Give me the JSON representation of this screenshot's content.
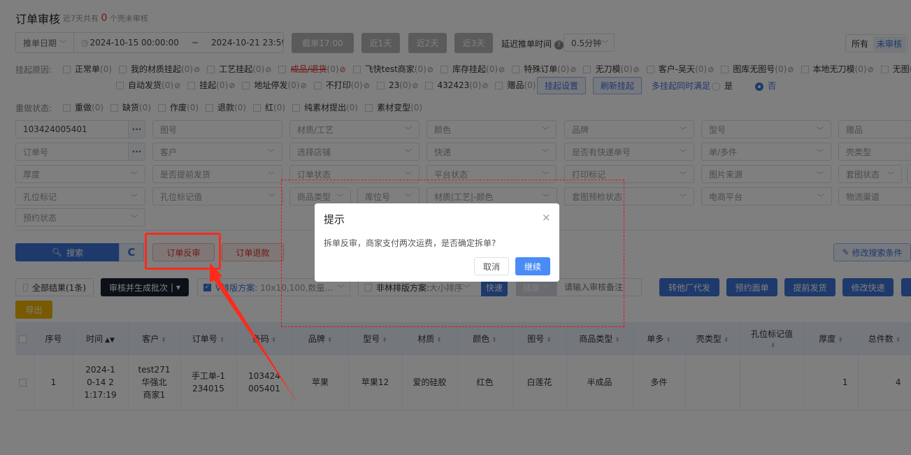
{
  "header": {
    "title": "订单审核",
    "subtitle_prefix": "近7天共有",
    "pending_count": "0",
    "subtitle_suffix": "个壳未审核"
  },
  "date_filter": {
    "type": "推单日期",
    "start": "2024-10-15 00:00:00",
    "separator": "~",
    "end": "2024-10-21 23:59:59"
  },
  "quick_buttons": [
    "截单17:00",
    "近1天",
    "近2天",
    "近3天"
  ],
  "delay": {
    "label": "延迟推单时间",
    "value": "0.5分钟"
  },
  "scope_toggle": {
    "options": [
      "所有",
      "未审核"
    ],
    "selected": "未审核"
  },
  "hang_reasons": {
    "label": "挂起原因:",
    "row1": [
      {
        "name": "正常单",
        "count": "(0)",
        "ban": false
      },
      {
        "name": "我的材质挂起",
        "count": "(0)",
        "ban": true
      },
      {
        "name": "工艺挂起",
        "count": "(0)",
        "ban": true
      },
      {
        "name": "成品/退货",
        "count": "(0)",
        "ban": true,
        "red": true
      },
      {
        "name": "飞快test商家",
        "count": "(0)",
        "ban": true
      },
      {
        "name": "库存挂起",
        "count": "(0)",
        "ban": true
      },
      {
        "name": "特殊订单",
        "count": "(0)",
        "ban": true
      },
      {
        "name": "无刀模",
        "count": "(0)",
        "ban": true
      },
      {
        "name": "客户-吴天",
        "count": "(0)",
        "ban": true
      },
      {
        "name": "图库无图号",
        "count": "(0)",
        "ban": true
      },
      {
        "name": "本地无刀模",
        "count": "(0)",
        "ban": true
      },
      {
        "name": "无图",
        "count": "(0)",
        "ban": true
      }
    ],
    "row2": [
      {
        "name": "自动发货",
        "count": "(0)",
        "ban": true
      },
      {
        "name": "挂起",
        "count": "(0)",
        "ban": true
      },
      {
        "name": "地址停发",
        "count": "(0)",
        "ban": true
      },
      {
        "name": "不打印",
        "count": "(0)",
        "ban": true
      },
      {
        "name": "23",
        "count": "(0)",
        "ban": true
      },
      {
        "name": "432423",
        "count": "(0)",
        "ban": true
      },
      {
        "name": "赠品",
        "count": "(0)",
        "ban": true
      }
    ],
    "settings_button": "挂起设置",
    "refresh_button": "刷新挂起",
    "multi_label": "多挂起同时满足",
    "radio_yes": "是",
    "radio_no": "否",
    "radio_selected": "否"
  },
  "redo_status": {
    "label": "重做状态:",
    "items": [
      {
        "name": "重做",
        "count": "(0)"
      },
      {
        "name": "缺货",
        "count": "(0)"
      },
      {
        "name": "作废",
        "count": "(0)"
      },
      {
        "name": "退款",
        "count": "(0)"
      },
      {
        "name": "红",
        "count": "(0)"
      },
      {
        "name": "纯素材提出",
        "count": "(0)"
      },
      {
        "name": "素材变型",
        "count": "(0)"
      }
    ]
  },
  "filters": [
    [
      {
        "text": "103424005401",
        "value": true,
        "more": true
      },
      {
        "text": "图号"
      },
      {
        "text": "材质/工艺",
        "chev": true
      },
      {
        "text": "颜色",
        "chev": true
      },
      {
        "text": "品牌",
        "chev": true
      },
      {
        "text": "型号",
        "chev": true
      },
      {
        "text": "赠品"
      }
    ],
    [
      {
        "text": "订单号",
        "more": true
      },
      {
        "text": "客户",
        "chev": true
      },
      {
        "text": "选择店铺",
        "chev": true
      },
      {
        "text": "快递",
        "chev": true
      },
      {
        "text": "是否有快递单号",
        "chev": true
      },
      {
        "text": "单/多件",
        "chev": true
      },
      {
        "text": "壳类型"
      }
    ],
    [
      {
        "text": "厚度",
        "chev": true
      },
      {
        "text": "是否提前发货",
        "chev": true
      },
      {
        "text": "订单状态",
        "chev": true
      },
      {
        "text": "平台状态",
        "chev": true
      },
      {
        "text": "打印标记",
        "chev": true
      },
      {
        "text": "图片来源",
        "chev": true
      },
      {
        "text": "套图状态",
        "chev": true
      }
    ],
    [
      {
        "text": "孔位标记",
        "chev": true
      },
      {
        "text": "孔位标记值",
        "chev": true
      },
      {
        "text": "商品类型",
        "chev": true
      },
      {
        "text": "库位号",
        "chev": true
      },
      {
        "text": "材质|工艺|-颜色",
        "chev": true
      },
      {
        "text": "套图预检状态",
        "chev": true
      },
      {
        "text": "电商平台",
        "chev": true
      },
      {
        "text": "物流渠道"
      }
    ],
    [
      {
        "text": "预约状态",
        "chev": true
      }
    ]
  ],
  "actions": {
    "search": "搜索",
    "reverse_review": "订单反审",
    "refund": "订单退款",
    "edit_conditions": "修改搜索条件"
  },
  "toolbar": {
    "all_results": "全部结果(1条)",
    "review_batch": "审核并生成批次",
    "layout_label": "V排版方案:",
    "layout_value": "10x10,100,数量...",
    "nonlin_label": "非林排版方案:",
    "nonlin_value": "大小排序",
    "fast": "快速",
    "flag": "插旗",
    "remark_placeholder": "请输入审核备注",
    "buttons": [
      "转他厂代发",
      "预约面单",
      "提前发货",
      "修改快递"
    ],
    "export": "导出"
  },
  "table": {
    "columns": [
      "序号",
      "时间",
      "客户",
      "订单号",
      "条码",
      "品牌",
      "型号",
      "材质",
      "颜色",
      "图号",
      "商品类型",
      "单多",
      "壳类型",
      "孔位标记值",
      "厚度",
      "总件数"
    ],
    "rows": [
      [
        "1",
        "2024-10-14 21:17:19",
        "test271华强北商家1",
        "手工单-1234015",
        "103424005401",
        "苹果",
        "苹果12",
        "爱的硅胶",
        "红色",
        "白莲花",
        "半成品",
        "多件",
        "",
        "",
        "1",
        "4"
      ]
    ]
  },
  "dialog": {
    "title": "提示",
    "message": "拆单反审，商家支付两次运费，是否确定拆单?",
    "cancel": "取消",
    "confirm": "继续"
  },
  "colors": {
    "primary": "#3d73d6",
    "danger": "#e0312b",
    "annotation": "#ff2a1a",
    "export": "#f0b400"
  }
}
